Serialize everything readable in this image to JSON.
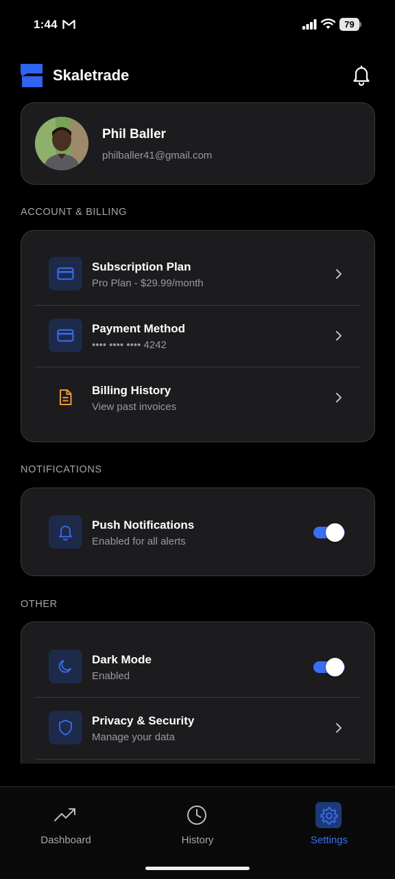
{
  "status_bar": {
    "time": "1:44",
    "battery": "79"
  },
  "header": {
    "app_title": "Skaletrade"
  },
  "profile": {
    "name": "Phil Baller",
    "email": "philballer41@gmail.com"
  },
  "sections": {
    "account_billing": {
      "label": "ACCOUNT & BILLING",
      "items": [
        {
          "title": "Subscription Plan",
          "subtitle": "Pro Plan - $29.99/month"
        },
        {
          "title": "Payment Method",
          "subtitle": "•••• •••• •••• 4242"
        },
        {
          "title": "Billing History",
          "subtitle": "View past invoices"
        }
      ]
    },
    "notifications": {
      "label": "NOTIFICATIONS",
      "items": [
        {
          "title": "Push Notifications",
          "subtitle": "Enabled for all alerts",
          "toggle_on": true
        }
      ]
    },
    "other": {
      "label": "OTHER",
      "items": [
        {
          "title": "Dark Mode",
          "subtitle": "Enabled",
          "toggle_on": true
        },
        {
          "title": "Privacy & Security",
          "subtitle": "Manage your data"
        }
      ]
    }
  },
  "bottom_nav": {
    "items": [
      {
        "label": "Dashboard",
        "icon": "trending-up-icon",
        "active": false
      },
      {
        "label": "History",
        "icon": "clock-icon",
        "active": false
      },
      {
        "label": "Settings",
        "icon": "gear-icon",
        "active": true
      }
    ]
  },
  "colors": {
    "accent": "#3b6ef5",
    "card_bg": "#1c1c1e",
    "icon_box_bg": "#1d2a4a",
    "billing_icon": "#f0963c"
  }
}
